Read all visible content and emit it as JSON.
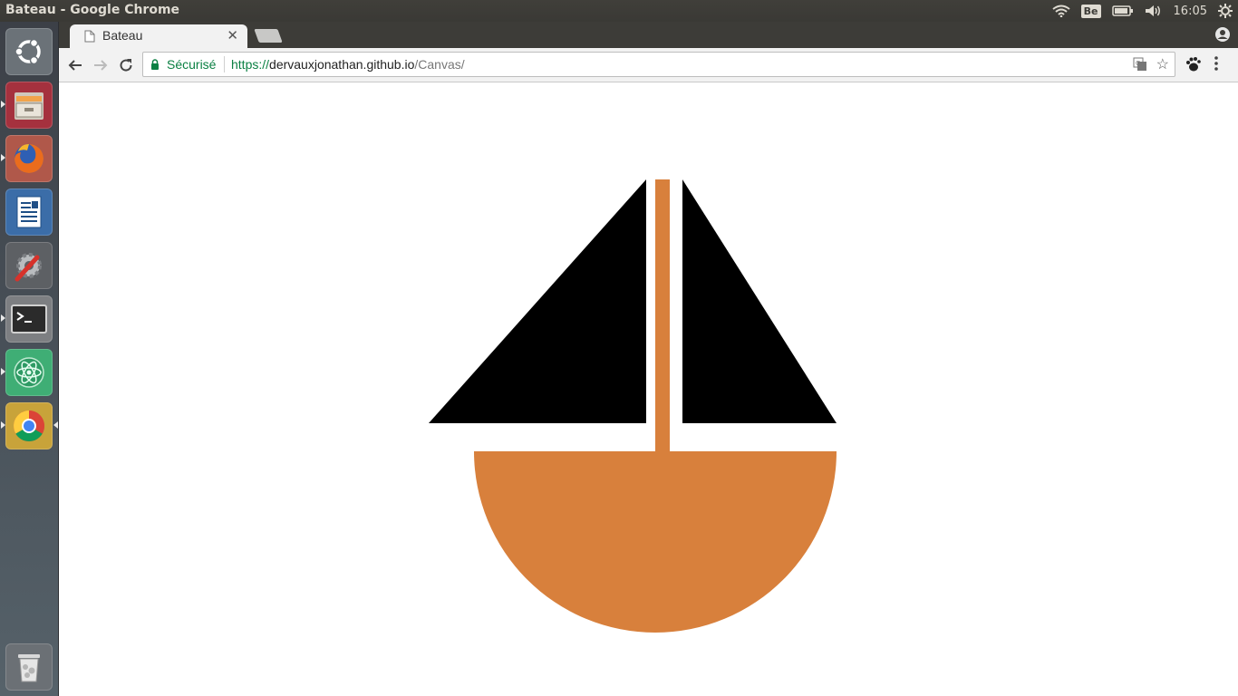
{
  "window": {
    "title": "Bateau - Google Chrome"
  },
  "panel": {
    "keyboard_layout": "Be",
    "clock": "16:05"
  },
  "launcher": {
    "items": [
      {
        "name": "Ubuntu Dash",
        "icon": "ubuntu-logo-icon"
      },
      {
        "name": "Files",
        "icon": "file-cabinet-icon"
      },
      {
        "name": "Firefox",
        "icon": "firefox-icon"
      },
      {
        "name": "LibreOffice Writer",
        "icon": "writer-document-icon"
      },
      {
        "name": "System Settings",
        "icon": "settings-wrench-icon"
      },
      {
        "name": "Terminal",
        "icon": "terminal-icon"
      },
      {
        "name": "Atom",
        "icon": "atom-icon"
      },
      {
        "name": "Google Chrome",
        "icon": "chrome-icon"
      },
      {
        "name": "Trash",
        "icon": "trash-icon"
      }
    ]
  },
  "browser": {
    "tabs": [
      {
        "title": "Bateau",
        "active": true
      }
    ],
    "omnibox": {
      "security_label": "Sécurisé",
      "scheme": "https://",
      "host": "dervauxjonathan.github.io",
      "path": "/Canvas/"
    }
  },
  "page": {
    "colors": {
      "sail": "#000000",
      "hull_and_mast": "#d8803c",
      "background": "#ffffff"
    }
  }
}
